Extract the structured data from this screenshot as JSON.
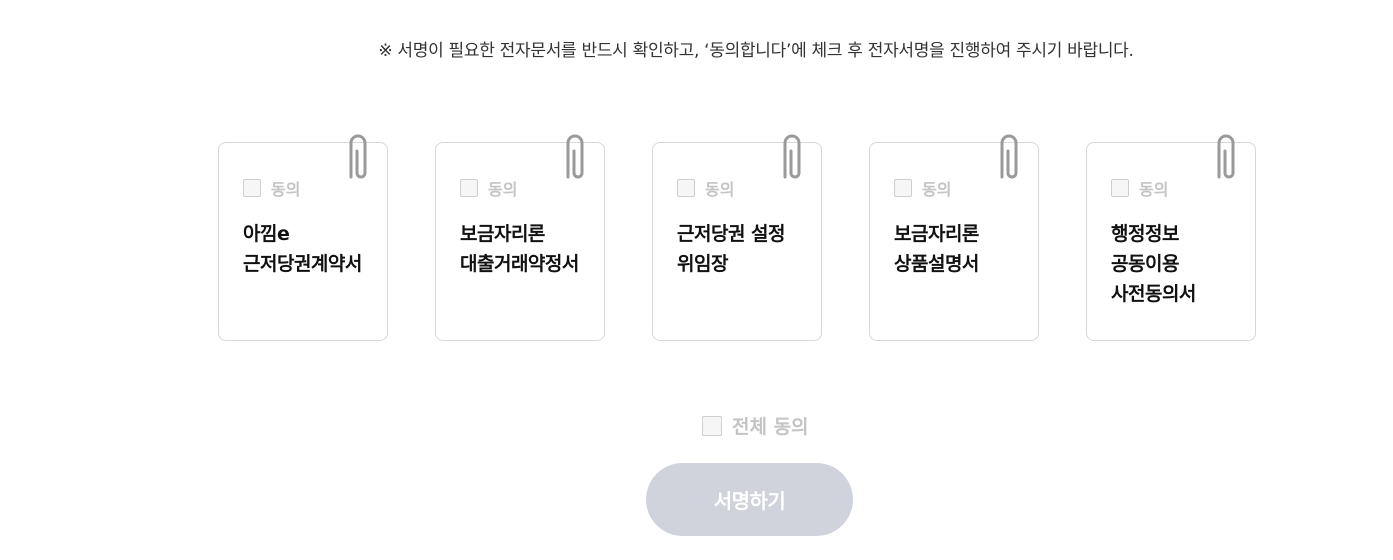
{
  "notice": "※ 서명이 필요한 전자문서를 반드시 확인하고, ‘동의합니다’에 체크 후 전자서명을 진행하여 주시기 바랍니다.",
  "documents": [
    {
      "agree_label": "동의",
      "title": "아낌e\n근저당권계약서",
      "checked": false
    },
    {
      "agree_label": "동의",
      "title": "보금자리론\n대출거래약정서",
      "checked": false
    },
    {
      "agree_label": "동의",
      "title": "근저당권 설정\n위임장",
      "checked": false
    },
    {
      "agree_label": "동의",
      "title": "보금자리론\n상품설명서",
      "checked": false
    },
    {
      "agree_label": "동의",
      "title": "행정정보\n공동이용\n사전동의서",
      "checked": false
    }
  ],
  "all_agree": {
    "label": "전체 동의",
    "checked": false
  },
  "sign_button": {
    "label": "서명하기",
    "enabled": false
  },
  "icons": {
    "clip": "paperclip-icon"
  },
  "colors": {
    "button_disabled": "#d0d3dc",
    "checkbox_border": "#cfcfcf",
    "label_disabled": "#c4c4c4",
    "card_border": "#d8d8d8"
  }
}
